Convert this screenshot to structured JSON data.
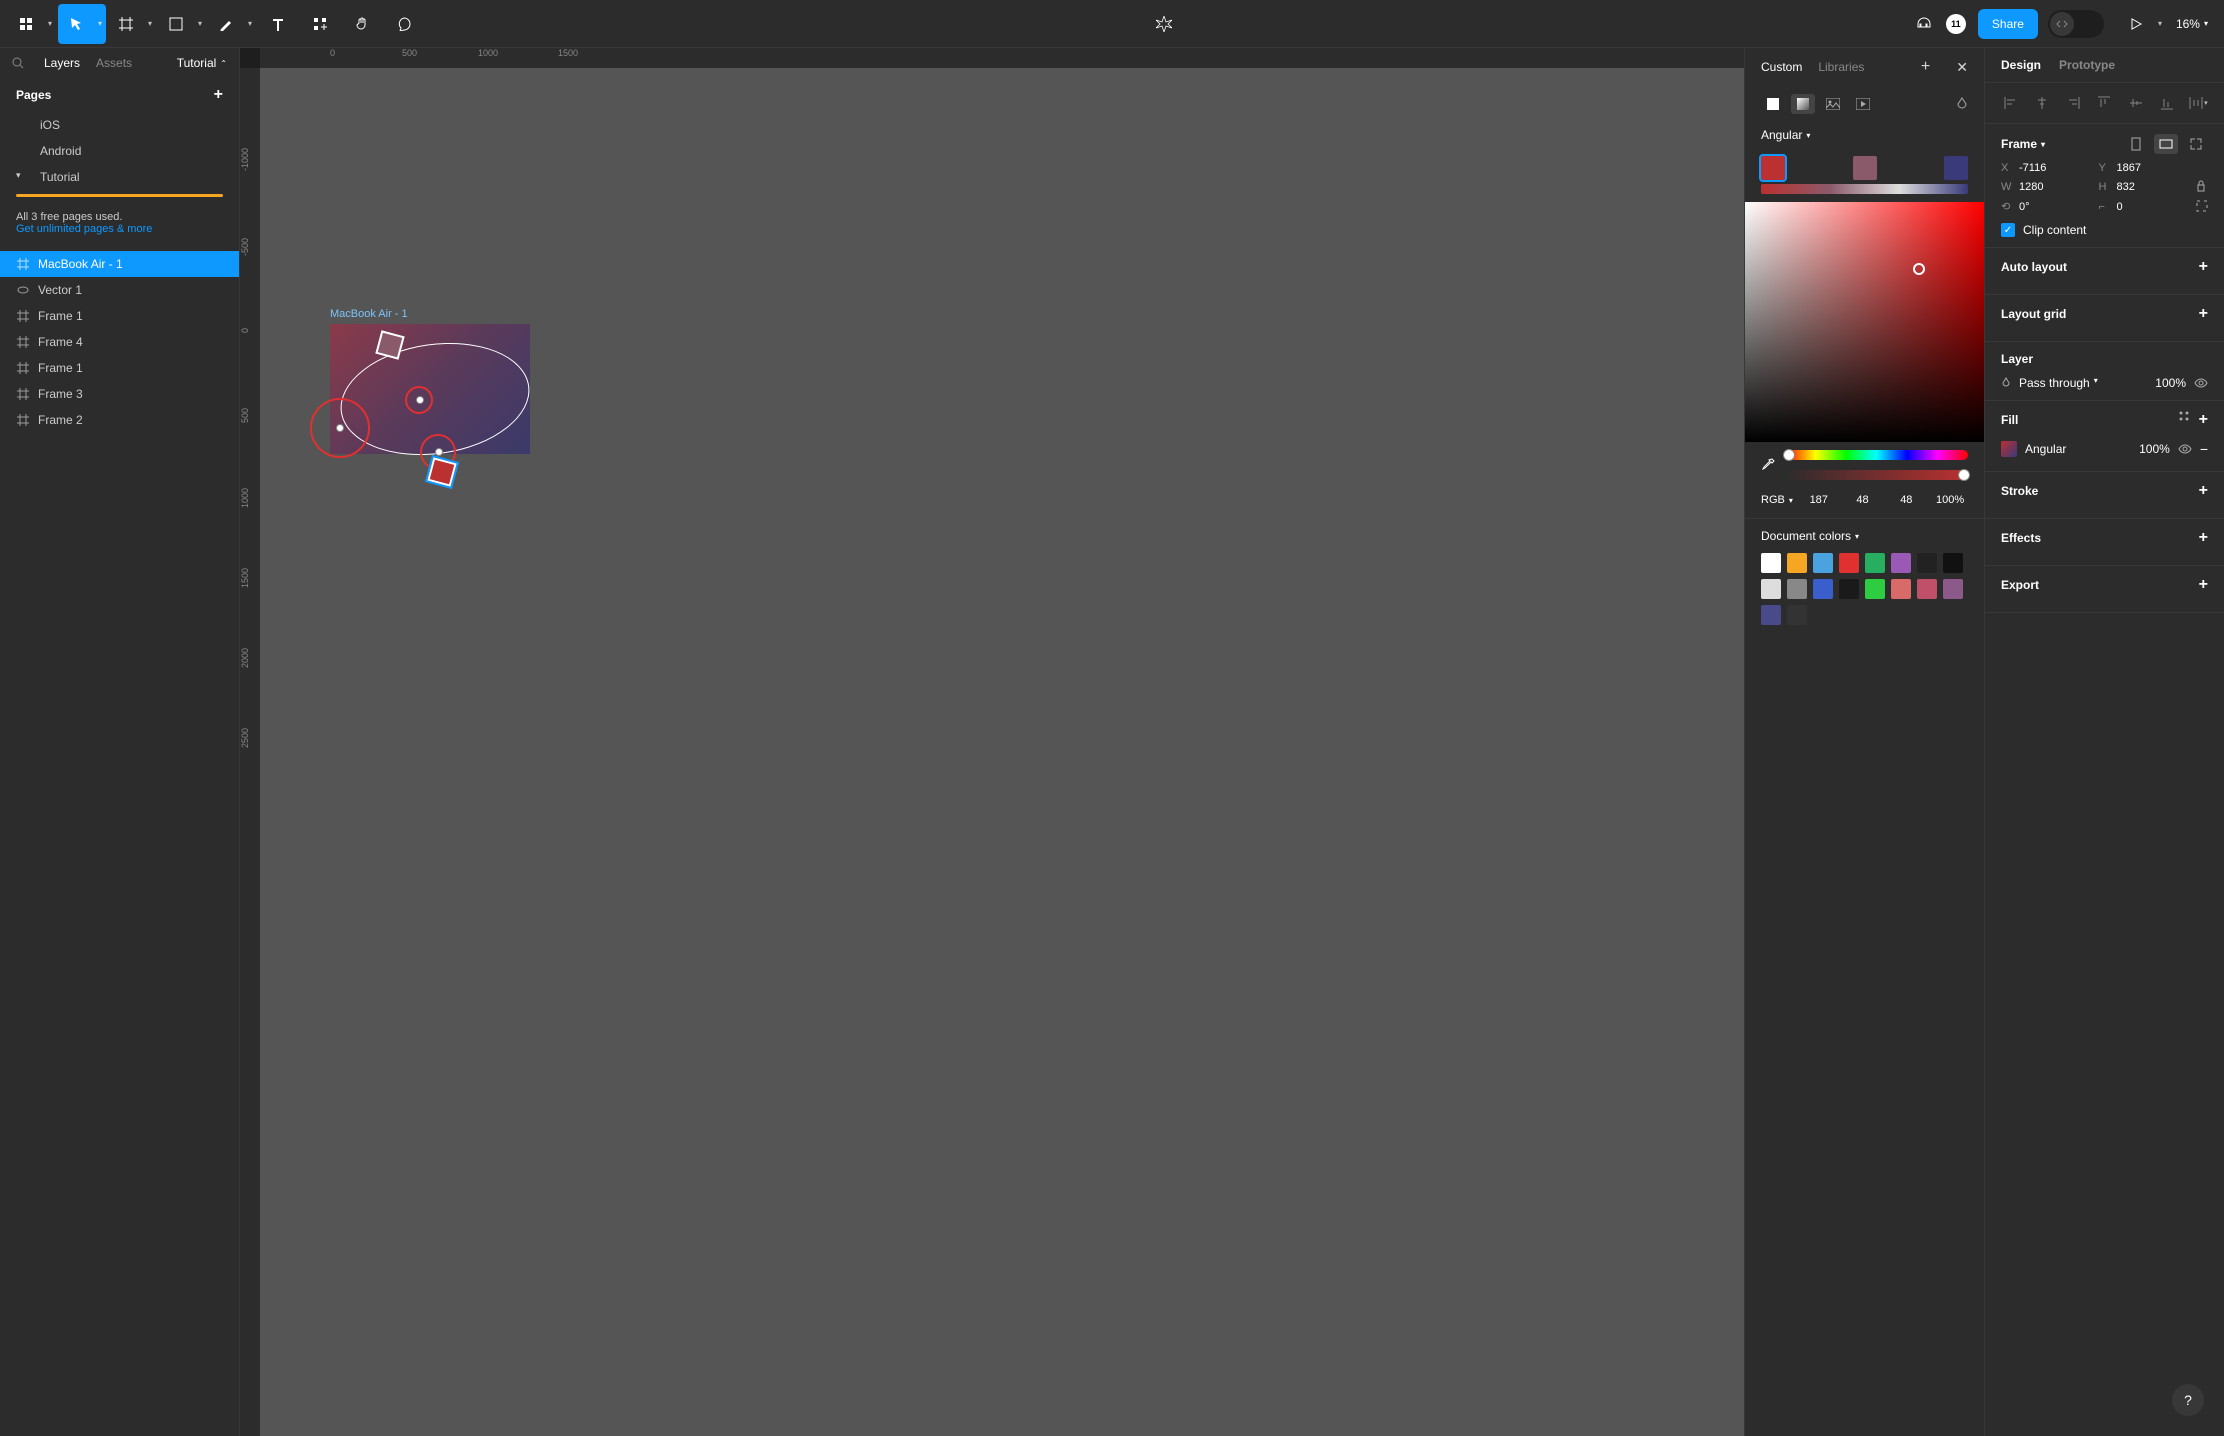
{
  "toolbar": {
    "share": "Share",
    "zoom": "16%",
    "avatar": "11"
  },
  "left": {
    "tabs": {
      "layers": "Layers",
      "assets": "Assets"
    },
    "filename": "Tutorial",
    "pages_hdr": "Pages",
    "pages": [
      "iOS",
      "Android",
      "Tutorial"
    ],
    "upgrade_l1": "All 3 free pages used.",
    "upgrade_l2": "Get unlimited pages & more",
    "layers": [
      {
        "name": "MacBook Air - 1",
        "icon": "frame"
      },
      {
        "name": "Vector 1",
        "icon": "vector"
      },
      {
        "name": "Frame 1",
        "icon": "frame"
      },
      {
        "name": "Frame 4",
        "icon": "frame"
      },
      {
        "name": "Frame 1",
        "icon": "frame"
      },
      {
        "name": "Frame 3",
        "icon": "frame"
      },
      {
        "name": "Frame 2",
        "icon": "frame"
      }
    ]
  },
  "canvas": {
    "frame_label": "MacBook Air - 1",
    "ruler_h": [
      "0",
      "500",
      "1000",
      "1500"
    ],
    "ruler_v": [
      "-1000",
      "-500",
      "0",
      "500",
      "1000",
      "1500",
      "2000",
      "2500"
    ]
  },
  "picker": {
    "tabs": {
      "custom": "Custom",
      "libraries": "Libraries"
    },
    "grad_type": "Angular",
    "color_mode": "RGB",
    "r": "187",
    "g": "48",
    "b": "48",
    "a": "100%",
    "doc_colors_hdr": "Document colors",
    "swatches": [
      "#ffffff",
      "#f5a623",
      "#4aa3df",
      "#e03030",
      "#27ae60",
      "#9b59b6",
      "#222222",
      "#111111",
      "#dddddd",
      "#888888",
      "#3a5fcd",
      "#1a1a1a",
      "#2ecc40",
      "#d96a6a",
      "#c0506a",
      "#8b5a8b",
      "#4a4a8a",
      "#333333"
    ],
    "stop_colors": [
      "#bb3030",
      "#8b5a6a",
      "#3a3a7a"
    ]
  },
  "right": {
    "tabs": {
      "design": "Design",
      "prototype": "Prototype"
    },
    "frame_label": "Frame",
    "x": "-7116",
    "y": "1867",
    "w": "1280",
    "h": "832",
    "rotation": "0°",
    "radius": "0",
    "clip": "Clip content",
    "auto_layout": "Auto layout",
    "layout_grid": "Layout grid",
    "layer_hdr": "Layer",
    "blend": "Pass through",
    "layer_opacity": "100%",
    "fill_hdr": "Fill",
    "fill_type": "Angular",
    "fill_opacity": "100%",
    "stroke": "Stroke",
    "effects": "Effects",
    "export": "Export"
  }
}
